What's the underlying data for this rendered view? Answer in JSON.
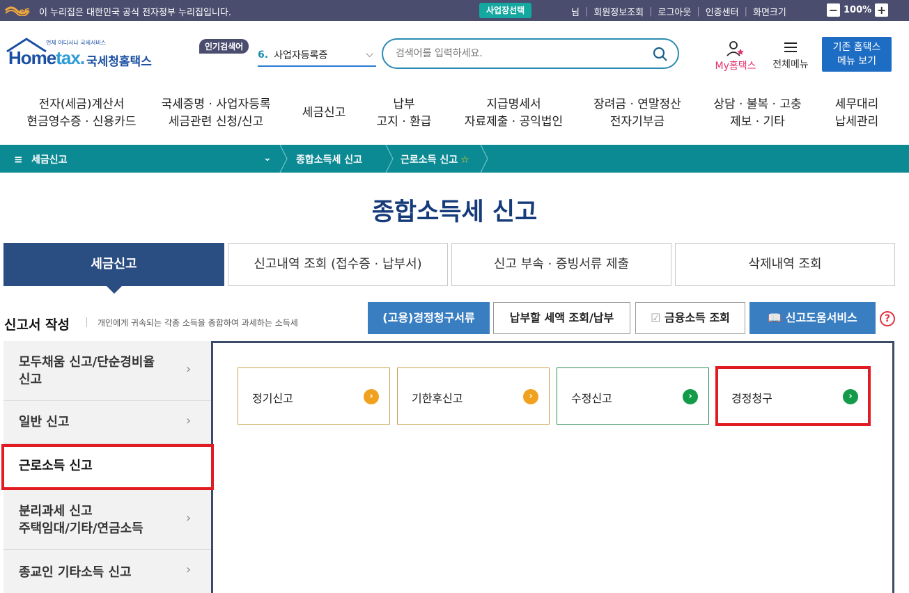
{
  "gov_bar": {
    "text": "이 누리집은 대한민국 공식 전자정부 누리집입니다.",
    "business_button": "사업장선택",
    "links": [
      "님",
      "회원정보조회",
      "로그아웃",
      "인증센터",
      "화면크기"
    ],
    "zoom_level": "100%",
    "zoom_minus": "−",
    "zoom_plus": "+"
  },
  "header": {
    "brand_small": "언제 어디서나 국세서비스",
    "brand_home": "Home",
    "brand_tax": "tax.",
    "brand_korean": "국세청홈택스",
    "popular_tag": "인기검색어",
    "popular_num": "6.",
    "popular_value": "사업자등록증",
    "search_placeholder": "검색어를 입력하세요.",
    "my_hometax_prefix": "My",
    "my_hometax_label": "홈택스",
    "all_menu_label": "전체메뉴",
    "old_menu_line1": "기존 홈택스",
    "old_menu_line2": "메뉴 보기"
  },
  "gnb": [
    {
      "line1": "전자(세금)계산서",
      "line2": "현금영수증 · 신용카드"
    },
    {
      "line1": "국세증명 · 사업자등록",
      "line2": "세금관련 신청/신고"
    },
    {
      "line1": "세금신고",
      "line2": ""
    },
    {
      "line1": "납부",
      "line2": "고지 · 환급"
    },
    {
      "line1": "지급명세서",
      "line2": "자료제출 · 공익법인"
    },
    {
      "line1": "장려금 · 연말정산",
      "line2": "전자기부금"
    },
    {
      "line1": "상담 · 불복 · 고충",
      "line2": "제보 · 기타"
    },
    {
      "line1": "세무대리",
      "line2": "납세관리"
    }
  ],
  "breadcrumb": {
    "menu_icon": "≡",
    "level1": "세금신고",
    "level2": "종합소득세 신고",
    "level3": "근로소득 신고"
  },
  "page_title": "종합소득세 신고",
  "tabs": [
    "세금신고",
    "신고내역 조회 (접수증 · 납부서)",
    "신고 부속 · 증빙서류 제출",
    "삭제내역 조회"
  ],
  "section": {
    "title": "신고서 작성",
    "description": "개인에게 귀속되는 각종 소득을 종합하여 과세하는 소득세"
  },
  "actions": {
    "claim_docs": "(고용)경정청구서류",
    "payment_lookup": "납부할 세액 조회/납부",
    "finance_income": "금융소득 조회",
    "help_service": "신고도움서비스",
    "help_icon": "?"
  },
  "sidebar": [
    {
      "line1": "모두채움 신고/단순경비율",
      "line2": "신고"
    },
    {
      "line1": "일반 신고",
      "line2": ""
    },
    {
      "line1": "근로소득 신고",
      "line2": ""
    },
    {
      "line1": "분리과세 신고",
      "line2": "주택임대/기타/연금소득"
    },
    {
      "line1": "종교인 기타소득 신고",
      "line2": ""
    }
  ],
  "cards": [
    {
      "label": "정기신고"
    },
    {
      "label": "기한후신고"
    },
    {
      "label": "수정신고"
    },
    {
      "label": "경정청구"
    }
  ],
  "colors": {
    "gov_bar": "#4a4d6e",
    "breadcrumb": "#0c8a94",
    "title": "#163b7a",
    "active_tab": "#2a4d82",
    "highlight": "#e11b22"
  }
}
